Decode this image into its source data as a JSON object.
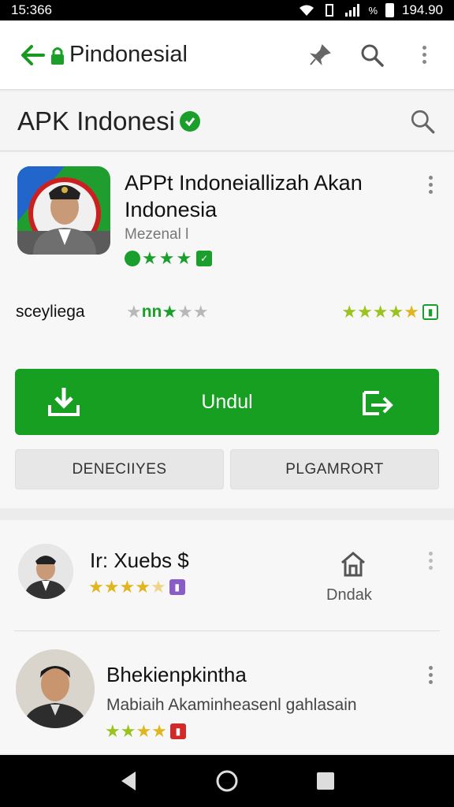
{
  "status_bar": {
    "time": "15:366",
    "signal_text": "%",
    "clock_right": "194.90"
  },
  "app_bar": {
    "title": "Pindonesial",
    "back_icon": "arrow-left-icon",
    "lock_icon": "lock-icon",
    "actions": [
      "pin-icon",
      "search-icon",
      "more-vert-icon"
    ]
  },
  "store_header": {
    "title": "APK Indonesi",
    "badge_icon": "verified-check-icon",
    "search_icon": "search-icon"
  },
  "app": {
    "name": "APPt Indoneiallizah Akan Indonesia",
    "developer": "Mezenal l",
    "rating_label": "sceyliega",
    "rating_mid_text": "nn",
    "install_label": "Undul",
    "secondary_buttons": [
      "DENECIIYES",
      "PLGAMRORT"
    ],
    "colors": {
      "accent": "#179f21",
      "star_gold": "#e0b51d",
      "star_green": "#1b9f2c"
    }
  },
  "list": [
    {
      "name": "Ir: Xuebs $",
      "action_label": "Dndak",
      "action_icon": "home-icon",
      "rating": 4.5,
      "badge_icon": "purple-tag-icon"
    },
    {
      "name": "Bhekienpkintha",
      "subtitle": "Mabiaih Akaminheasenl gahlasain",
      "rating": 4,
      "badge_icon": "red-tag-icon"
    }
  ],
  "nav": [
    "back-triangle-icon",
    "home-circle-icon",
    "recents-square-icon"
  ]
}
